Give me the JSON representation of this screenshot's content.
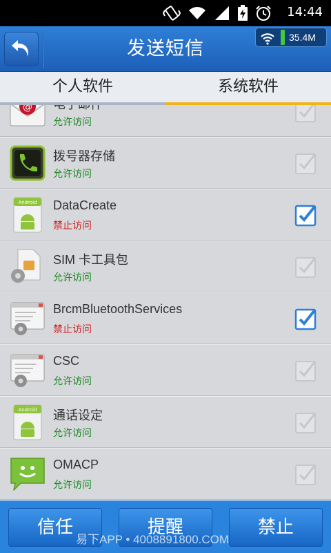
{
  "status_bar": {
    "time": "14:44"
  },
  "header": {
    "title": "发送短信",
    "network_usage": "35.4M"
  },
  "tabs": [
    {
      "label": "个人软件",
      "selected": false
    },
    {
      "label": "系统软件",
      "selected": true
    }
  ],
  "apps": [
    {
      "name": "电子邮件",
      "status": "允许访问",
      "status_type": "allow",
      "checked": false,
      "icon": "email-icon"
    },
    {
      "name": "拨号器存储",
      "status": "允许访问",
      "status_type": "allow",
      "checked": false,
      "icon": "phone-icon"
    },
    {
      "name": "DataCreate",
      "status": "禁止访问",
      "status_type": "deny",
      "checked": true,
      "icon": "android-icon"
    },
    {
      "name": "SIM 卡工具包",
      "status": "允许访问",
      "status_type": "allow",
      "checked": false,
      "icon": "sim-card-icon"
    },
    {
      "name": "BrcmBluetoothServices",
      "status": "禁止访问",
      "status_type": "deny",
      "checked": true,
      "icon": "window-gear-icon"
    },
    {
      "name": "CSC",
      "status": "允许访问",
      "status_type": "allow",
      "checked": false,
      "icon": "window-gear-icon"
    },
    {
      "name": "通话设定",
      "status": "允许访问",
      "status_type": "allow",
      "checked": false,
      "icon": "android-icon"
    },
    {
      "name": "OMACP",
      "status": "允许访问",
      "status_type": "allow",
      "checked": false,
      "icon": "message-icon"
    }
  ],
  "bottom_buttons": {
    "trust": "信任",
    "remind": "提醒",
    "forbid": "禁止"
  },
  "watermark": "易下APP • 4008891800.COM",
  "colors": {
    "titlebar": "#1d5fb8",
    "tab_active_underline": "#f0b31c",
    "allow": "#15881e",
    "deny": "#d0201f",
    "bottom_bar": "#2a83dc"
  }
}
